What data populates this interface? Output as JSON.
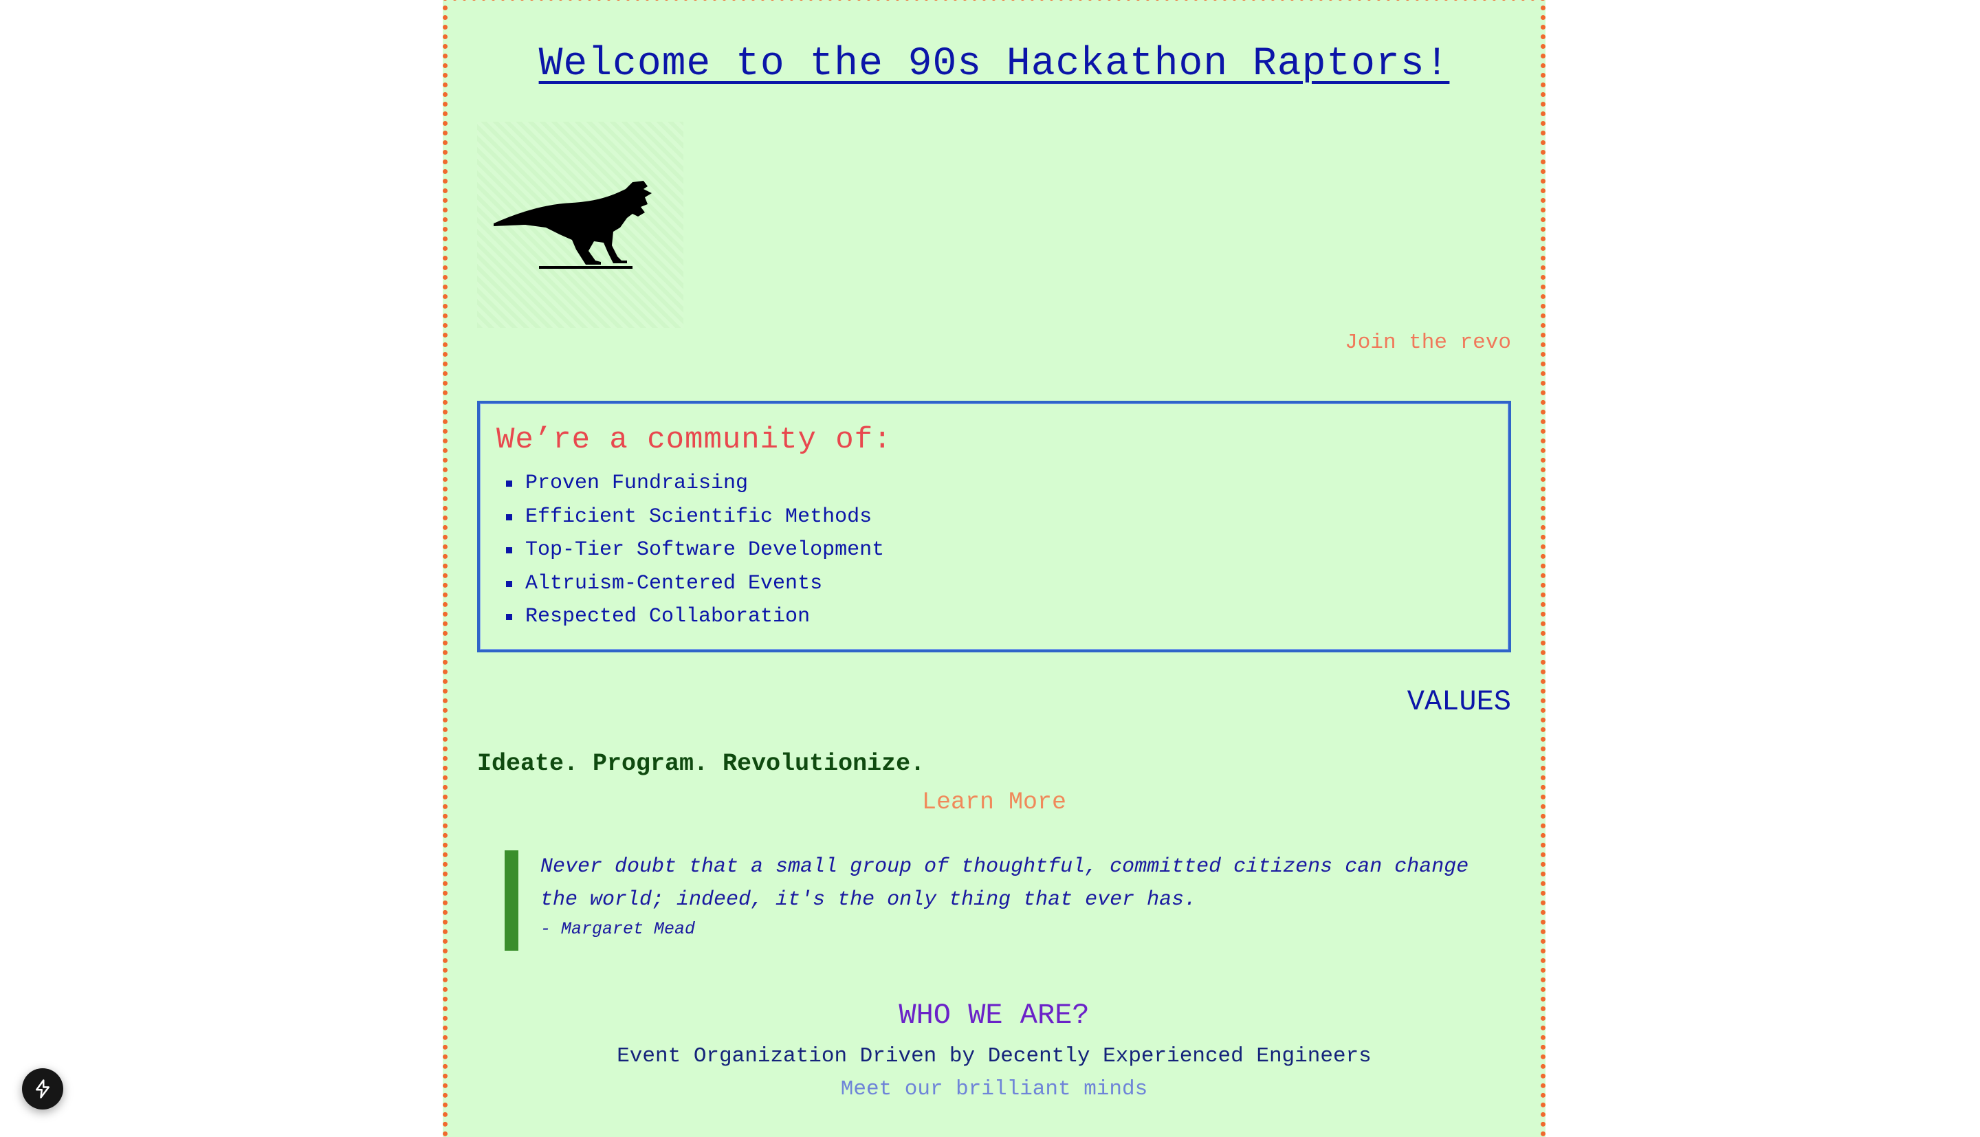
{
  "header": {
    "title": "Welcome to the 90s Hackathon Raptors!"
  },
  "logo": {
    "icon": "raptor-icon"
  },
  "join_link": "Join the revo",
  "community": {
    "heading": "We’re a community of:",
    "items": [
      "Proven Fundraising",
      "Efficient Scientific Methods",
      "Top-Tier Software Development",
      "Altruism-Centered Events",
      "Respected Collaboration"
    ]
  },
  "values": {
    "heading": "VALUES",
    "tagline": "Ideate. Program. Revolutionize.",
    "learn_more": "Learn More"
  },
  "quote": {
    "text": "Never doubt that a small group of thoughtful, committed citizens can change the world; indeed, it's the only thing that ever has.",
    "author": "- Margaret Mead"
  },
  "who": {
    "heading": "WHO WE ARE?",
    "subtitle": "Event Organization Driven by Decently Experienced Engineers",
    "link": "Meet our brilliant minds"
  },
  "floating_button": {
    "icon": "lightning-bolt-icon"
  },
  "colors": {
    "page_background": "#d6fcd0",
    "border_dots": "#f0692f",
    "title_blue": "#0b15a8",
    "heading_red": "#e8484e",
    "box_border": "#2f64c8",
    "quote_bar": "#3a8e2c",
    "who_purple": "#6b22c8"
  }
}
